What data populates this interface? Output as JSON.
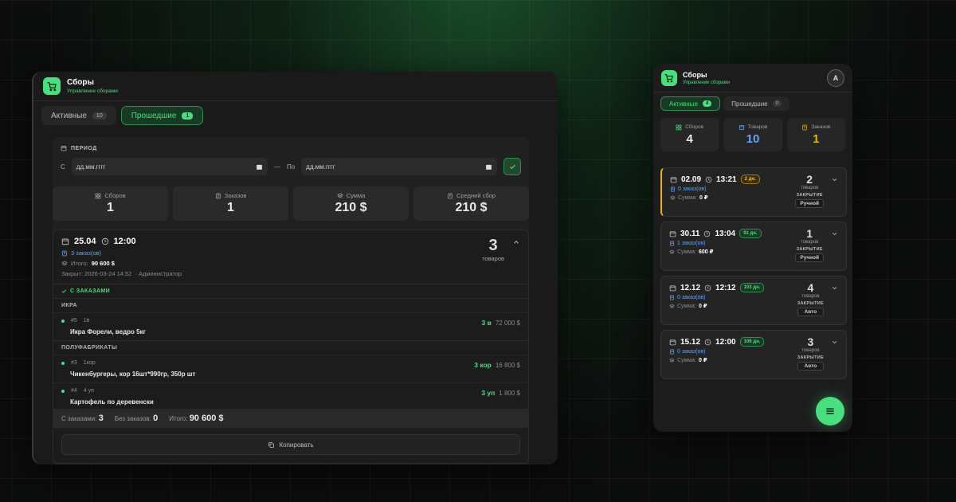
{
  "header": {
    "title": "Сборы",
    "subtitle": "Управление сборами"
  },
  "tabs": {
    "active_label": "Активные",
    "active_count": "10",
    "past_label": "Прошедшие",
    "past_count": "1"
  },
  "period": {
    "label": "ПЕРИОД",
    "from_label": "С",
    "to_label": "По",
    "dash": "—",
    "from_placeholder": "дд.мм.гггг",
    "to_placeholder": "дд.мм.гггг"
  },
  "stats": [
    {
      "label": "Сборов",
      "value": "1"
    },
    {
      "label": "Заказов",
      "value": "1"
    },
    {
      "label": "Сумма",
      "value": "210 $"
    },
    {
      "label": "Средний сбор",
      "value": "210 $"
    }
  ],
  "order": {
    "date": "25.04",
    "time": "12:00",
    "orders": "3 заказ(ов)",
    "total_label": "Итого:",
    "total": "90 600 $",
    "closed": "Закрыт: 2026-03-24 14:52",
    "closed_by": "· Администратор",
    "count": "3",
    "count_unit": "товаров",
    "with_orders": "С ЗАКАЗАМИ",
    "groups": [
      {
        "name": "ИКРА",
        "items": [
          {
            "num": "#5",
            "pack": "1в",
            "name": "Икра Форели, ведро 5кг",
            "qty": "3 в",
            "sum": "72 000 $"
          }
        ]
      },
      {
        "name": "ПОЛУФАБРИКАТЫ",
        "items": [
          {
            "num": "#3",
            "pack": "1кор",
            "name": "Чикенбургеры, кор 16шт*990гр, 350р шт",
            "qty": "3 кор",
            "sum": "16 800 $"
          },
          {
            "num": "#4",
            "pack": "4 уп",
            "name": "Картофель по деревенски",
            "qty": "3 уп",
            "sum": "1 800 $"
          }
        ]
      }
    ],
    "footer": {
      "with_label": "С заказами:",
      "with_value": "3",
      "without_label": "Без заказов:",
      "without_value": "0",
      "total_label": "Итого:",
      "total_value": "90 600 $"
    },
    "copy_label": "Копировать"
  },
  "mobile": {
    "title": "Сборы",
    "subtitle": "Управление сборами",
    "avatar": "A",
    "tabs": {
      "active_label": "Активные",
      "active_count": "4",
      "past_label": "Прошедшие",
      "past_count": "0"
    },
    "stats": [
      {
        "label": "Сборов",
        "value": "4",
        "color": "#4ade80"
      },
      {
        "label": "Товаров",
        "value": "10",
        "color": "#60a5fa"
      },
      {
        "label": "Заказов",
        "value": "1",
        "color": "#eab308"
      }
    ],
    "cards": [
      {
        "date": "02.09",
        "time": "13:21",
        "badge": "2 дн.",
        "orders": "0 заказ(ов)",
        "sum_label": "Сумма:",
        "sum": "0 ₽",
        "count": "2",
        "unit": "товаров",
        "closing_label": "ЗАКРЫТИЕ",
        "closing": "Ручной"
      },
      {
        "date": "30.11",
        "time": "13:04",
        "badge": "91 дн.",
        "orders": "1 заказ(ов)",
        "sum_label": "Сумма:",
        "sum": "600 ₽",
        "count": "1",
        "unit": "товаров",
        "closing_label": "ЗАКРЫТИЕ",
        "closing": "Ручной"
      },
      {
        "date": "12.12",
        "time": "12:12",
        "badge": "103 дн.",
        "orders": "0 заказ(ов)",
        "sum_label": "Сумма:",
        "sum": "0 ₽",
        "count": "4",
        "unit": "товаров",
        "closing_label": "ЗАКРЫТИЕ",
        "closing": "Авто"
      },
      {
        "date": "15.12",
        "time": "12:00",
        "badge": "106 дн.",
        "orders": "0 заказ(ов)",
        "sum_label": "Сумма:",
        "sum": "0 ₽",
        "count": "3",
        "unit": "товаров",
        "closing_label": "ЗАКРЫТИЕ",
        "closing": "Авто"
      }
    ]
  },
  "colors": {
    "accent": "#4ade80",
    "warning": "#eab308",
    "info": "#60a5fa",
    "panel": "#1a1a1a"
  }
}
